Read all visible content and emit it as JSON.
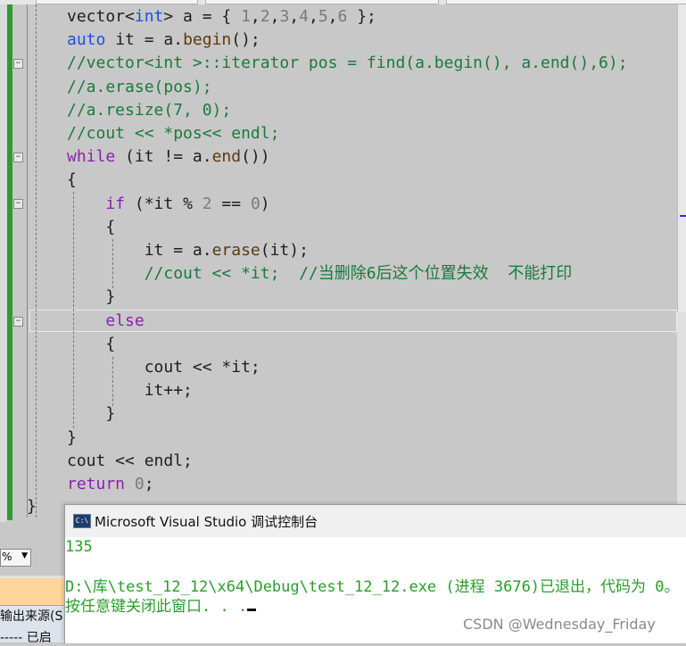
{
  "editor": {
    "lines": [
      [
        {
          "t": "vector<",
          "c": ""
        },
        {
          "t": "int",
          "c": "ty"
        },
        {
          "t": "> a = { ",
          "c": ""
        },
        {
          "t": "1",
          "c": "num"
        },
        {
          "t": ",",
          "c": ""
        },
        {
          "t": "2",
          "c": "num"
        },
        {
          "t": ",",
          "c": ""
        },
        {
          "t": "3",
          "c": "num"
        },
        {
          "t": ",",
          "c": ""
        },
        {
          "t": "4",
          "c": "num"
        },
        {
          "t": ",",
          "c": ""
        },
        {
          "t": "5",
          "c": "num"
        },
        {
          "t": ",",
          "c": ""
        },
        {
          "t": "6",
          "c": "num"
        },
        {
          "t": " };",
          "c": ""
        }
      ],
      [
        {
          "t": "auto",
          "c": "kw2"
        },
        {
          "t": " it = a.",
          "c": ""
        },
        {
          "t": "begin",
          "c": "fn"
        },
        {
          "t": "();",
          "c": ""
        }
      ],
      [
        {
          "t": "//vector<int >::iterator pos = find(a.begin(), a.end(),6);",
          "c": "cm"
        }
      ],
      [
        {
          "t": "//a.erase(pos);",
          "c": "cm"
        }
      ],
      [
        {
          "t": "//a.resize(7, 0);",
          "c": "cm"
        }
      ],
      [
        {
          "t": "//cout << *pos<< endl;",
          "c": "cm"
        }
      ],
      [
        {
          "t": "while",
          "c": "kw"
        },
        {
          "t": " (it != a.",
          "c": ""
        },
        {
          "t": "end",
          "c": "fn"
        },
        {
          "t": "())",
          "c": ""
        }
      ],
      [
        {
          "t": "{",
          "c": ""
        }
      ],
      [
        {
          "t": "    ",
          "c": ""
        },
        {
          "t": "if",
          "c": "kw"
        },
        {
          "t": " (*it % ",
          "c": ""
        },
        {
          "t": "2",
          "c": "num"
        },
        {
          "t": " == ",
          "c": ""
        },
        {
          "t": "0",
          "c": "num"
        },
        {
          "t": ")",
          "c": ""
        }
      ],
      [
        {
          "t": "    {",
          "c": ""
        }
      ],
      [
        {
          "t": "        it = a.",
          "c": ""
        },
        {
          "t": "erase",
          "c": "fn"
        },
        {
          "t": "(it);",
          "c": ""
        }
      ],
      [
        {
          "t": "        ",
          "c": ""
        },
        {
          "t": "//cout << *it;  //当删除6后这个位置失效  不能打印",
          "c": "cm"
        }
      ],
      [
        {
          "t": "    }",
          "c": ""
        }
      ],
      [
        {
          "t": "    ",
          "c": ""
        },
        {
          "t": "else",
          "c": "kw"
        }
      ],
      [
        {
          "t": "    {",
          "c": ""
        }
      ],
      [
        {
          "t": "        cout << *it;",
          "c": ""
        }
      ],
      [
        {
          "t": "        it++;",
          "c": ""
        }
      ],
      [
        {
          "t": "    }",
          "c": ""
        }
      ],
      [
        {
          "t": "}",
          "c": ""
        }
      ],
      [
        {
          "t": "cout << endl;",
          "c": ""
        }
      ],
      [
        {
          "t": "return",
          "c": "kw"
        },
        {
          "t": " ",
          "c": ""
        },
        {
          "t": "0",
          "c": "num"
        },
        {
          "t": ";",
          "c": ""
        }
      ]
    ],
    "closing_brace": "}"
  },
  "console": {
    "title": "Microsoft Visual Studio 调试控制台",
    "icon": "console-app-icon",
    "icon_text": "C:\\",
    "output_line1": "135",
    "output_line2": "D:\\库\\test_12_12\\x64\\Debug\\test_12_12.exe (进程 3676)已退出，代码为 0。",
    "output_line3": "按任意键关闭此窗口. . ."
  },
  "bottom_left": {
    "dropdown_value": "%",
    "label1": "输出来源(S",
    "label2": "----- 已启"
  },
  "watermark": "CSDN @Wednesday_Friday",
  "colors": {
    "keyword": "#8a1fb3",
    "type": "#1a4fe0",
    "comment": "#1a7a3a",
    "console_text": "#2a9d2a",
    "change_bar": "#2e9b2e"
  }
}
